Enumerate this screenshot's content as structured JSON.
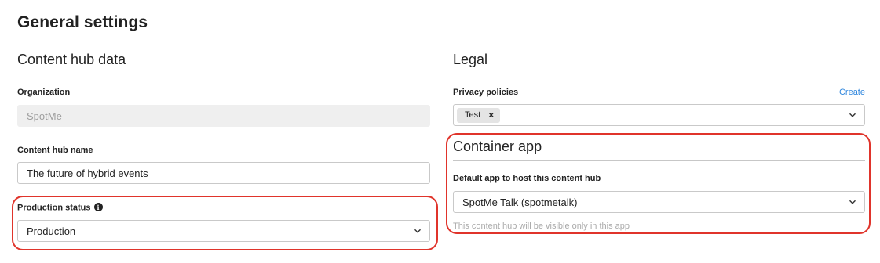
{
  "page": {
    "title": "General settings"
  },
  "left": {
    "section_title": "Content hub data",
    "organization": {
      "label": "Organization",
      "value": "SpotMe"
    },
    "hub_name": {
      "label": "Content hub name",
      "value": "The future of hybrid events"
    },
    "production_status": {
      "label": "Production status",
      "value": "Production"
    }
  },
  "right": {
    "section_title": "Legal",
    "privacy": {
      "label": "Privacy policies",
      "create_label": "Create",
      "tags": [
        "Test"
      ]
    },
    "container": {
      "section_title": "Container app",
      "label": "Default app to host this content hub",
      "value": "SpotMe Talk (spotmetalk)",
      "help": "This content hub will be visible only in this app"
    }
  },
  "colors": {
    "link": "#2e86de",
    "highlight": "#e0342b",
    "disabled_bg": "#efefef"
  }
}
